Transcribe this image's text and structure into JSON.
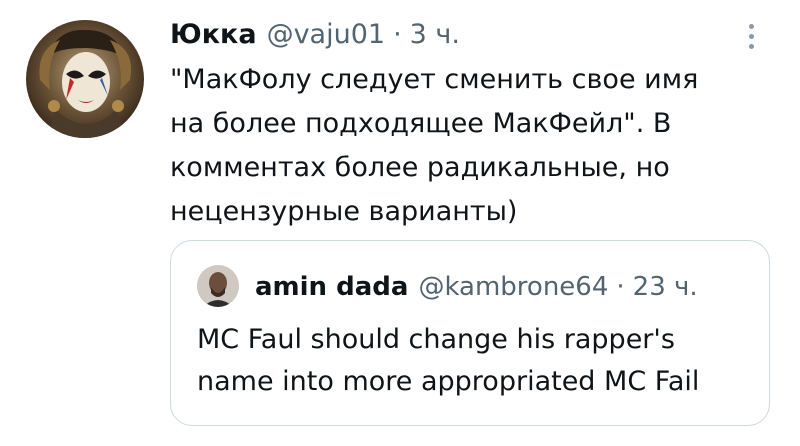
{
  "tweet": {
    "author_name": "Юкка",
    "handle": "@vaju01",
    "separator": "·",
    "time": "3 ч.",
    "text_lines": [
      "\"МакФолу следует сменить свое имя",
      "на более подходящее МакФейл\".  В",
      "комментах более радикальные, но",
      "нецензурные варианты)"
    ]
  },
  "quote": {
    "author_name": "amin dada",
    "handle": "@kambrone64",
    "separator": "·",
    "time": "23 ч.",
    "text_lines": [
      "MC Faul should change his rapper's",
      "name into more appropriated MC Fail"
    ]
  },
  "icons": {
    "more": "more-vertical-icon"
  },
  "colors": {
    "text": "#0f1419",
    "secondary": "#536471",
    "border": "#cfd9de"
  }
}
